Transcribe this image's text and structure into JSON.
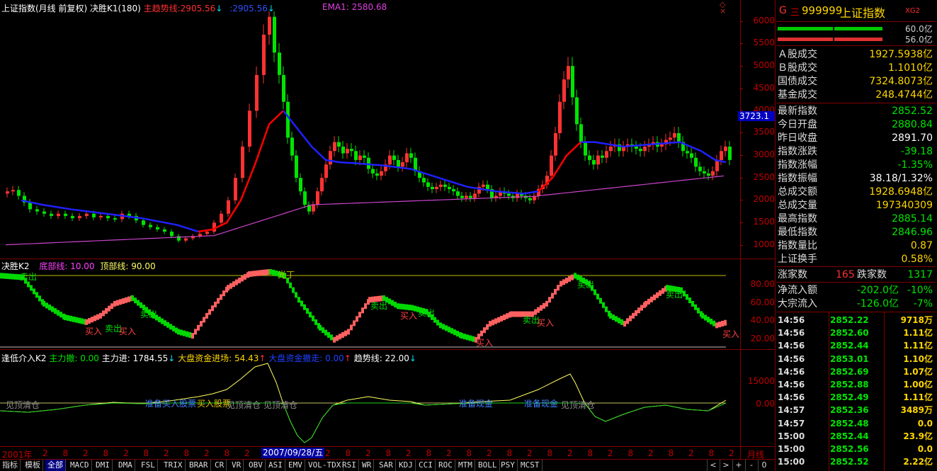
{
  "main_title": {
    "name": "上证指数(月线 前复权)",
    "k1": "决胜K1(180)",
    "trend_label": "主趋势线:",
    "trend_value": "2905.56",
    "trend2": ":2905.56",
    "ema_label": "EMA1: 2580.68",
    "arrow_down": "↓",
    "arrow_down2": "↓"
  },
  "price_axis": [
    "6000",
    "5500",
    "5000",
    "4500",
    "4000",
    "3500",
    "3000",
    "2500",
    "2000",
    "1500",
    "1000"
  ],
  "current_price_tag": "3723.1",
  "sub1": {
    "title": "决胜K2",
    "bottom_label": "底部线: 10.00",
    "top_label": "顶部线: 90.00",
    "axis": [
      "80.00",
      "60.00",
      "40.00",
      "20.00"
    ],
    "labels": {
      "sell": "卖出",
      "buy": "买入",
      "top": "光丁"
    }
  },
  "sub2": {
    "title": "逢低介入K2",
    "l1": "主力撤: 0.00",
    "l2": "主力进: 1784.55",
    "l2_arrow": "↓",
    "l3": "大盘资金进场: 54.43",
    "l3_arrow": "↑",
    "l4": "大盘资金撤走: 0.00",
    "l4_arrow": "↑",
    "l5": "趋势线: 22.00",
    "l5_arrow": "↓",
    "axis": [
      "15000",
      "0.00"
    ],
    "annotations": {
      "a1": "见顶清仓",
      "a2": "准备买入股票",
      "a3": "买入股票",
      "a4": "见顶清仓",
      "a5": "见顶清仓",
      "a6": "准备现金",
      "a7": "准备现金",
      "a8": "见顶清仓"
    }
  },
  "time_axis": {
    "start": "2001年",
    "highlight": "2007/09/28/五",
    "period": "月线",
    "ticks": [
      "2",
      "8",
      "2",
      "8",
      "2",
      "8",
      "2",
      "8",
      "2",
      "8",
      "2",
      "8",
      "2",
      "8",
      "2",
      "8",
      "2",
      "8",
      "2",
      "8",
      "2",
      "8",
      "2",
      "8",
      "2",
      "8",
      "2",
      "8",
      "2",
      "8",
      "2",
      "8",
      "2",
      "8",
      "2"
    ]
  },
  "tabs": [
    "指标",
    "模板",
    "全部",
    "MACD",
    "DMI",
    "DMA",
    "FSL",
    "TRIX",
    "BRAR",
    "CR",
    "VR",
    "OBV",
    "ASI",
    "EMV",
    "VOL-TDX",
    "RSI",
    "WR",
    "SAR",
    "KDJ",
    "CCI",
    "ROC",
    "MTM",
    "BOLL",
    "PSY",
    "MCST"
  ],
  "bottom_controls": [
    "<",
    ">",
    "+",
    "-",
    "0"
  ],
  "right_panel": {
    "header_g": "G",
    "header_menu": "三",
    "code": "999999",
    "name": "上证指数",
    "tag": "XG2",
    "bar1_label": "60.0亿",
    "bar2_label": "56.0亿",
    "stats_a": [
      {
        "label": "Ａ股成交",
        "value": "1927.5938亿"
      },
      {
        "label": "Ｂ股成交",
        "value": "1.1010亿"
      },
      {
        "label": "国债成交",
        "value": "7324.8073亿"
      },
      {
        "label": "基金成交",
        "value": "248.4744亿"
      }
    ],
    "stats_b": [
      {
        "label": "最新指数",
        "value": "2852.52",
        "color": "green"
      },
      {
        "label": "今日开盘",
        "value": "2880.84",
        "color": "green"
      },
      {
        "label": "昨日收盘",
        "value": "2891.70",
        "color": "white"
      },
      {
        "label": "指数涨跌",
        "value": "-39.18",
        "color": "green"
      },
      {
        "label": "指数涨幅",
        "value": "-1.35%",
        "color": "green"
      },
      {
        "label": "指数振幅",
        "value": "38.18/1.32%",
        "color": "white"
      },
      {
        "label": "总成交额",
        "value": "1928.6948亿",
        "color": "yellow"
      },
      {
        "label": "总成交量",
        "value": "197340309",
        "color": "yellow"
      },
      {
        "label": "最高指数",
        "value": "2885.14",
        "color": "green"
      },
      {
        "label": "最低指数",
        "value": "2846.96",
        "color": "green"
      },
      {
        "label": "指数量比",
        "value": "0.87",
        "color": "yellow"
      },
      {
        "label": "上证换手",
        "value": "0.58%",
        "color": "yellow"
      }
    ],
    "rise_label": "涨家数",
    "rise_value": "165",
    "fall_label": "跌家数",
    "fall_value": "1317",
    "flow1_label": "净流入额",
    "flow1_value": "-202.0亿",
    "flow1_pct": "-10%",
    "flow2_label": "大宗流入",
    "flow2_value": "-126.0亿",
    "flow2_pct": "-7%",
    "ticks": [
      {
        "time": "14:56",
        "price": "2852.22",
        "vol": "9718万",
        "vc": "yellow"
      },
      {
        "time": "14:56",
        "price": "2852.60",
        "vol": "1.11亿",
        "vc": "yellow"
      },
      {
        "time": "14:56",
        "price": "2852.44",
        "vol": "1.11亿",
        "vc": "yellow"
      },
      {
        "time": "14:56",
        "price": "2853.01",
        "vol": "1.10亿",
        "vc": "yellow"
      },
      {
        "time": "14:56",
        "price": "2852.69",
        "vol": "1.07亿",
        "vc": "yellow"
      },
      {
        "time": "14:56",
        "price": "2852.88",
        "vol": "1.00亿",
        "vc": "yellow"
      },
      {
        "time": "14:56",
        "price": "2852.49",
        "vol": "1.11亿",
        "vc": "yellow"
      },
      {
        "time": "14:57",
        "price": "2852.36",
        "vol": "3489万",
        "vc": "yellow"
      },
      {
        "time": "14:57",
        "price": "2852.48",
        "vol": "0.0",
        "vc": "yellow"
      },
      {
        "time": "15:00",
        "price": "2852.44",
        "vol": "23.9亿",
        "vc": "yellow"
      },
      {
        "time": "15:00",
        "price": "2852.56",
        "vol": "0.0",
        "vc": "yellow"
      },
      {
        "time": "15:00",
        "price": "2852.52",
        "vol": "2.22亿",
        "vc": "yellow"
      }
    ]
  },
  "colors": {
    "up": "#ff3232",
    "down": "#00e400",
    "ema": "#cc44cc",
    "trend_up": "#ff0000",
    "trend_down": "#2020ff",
    "border": "#800000"
  }
}
